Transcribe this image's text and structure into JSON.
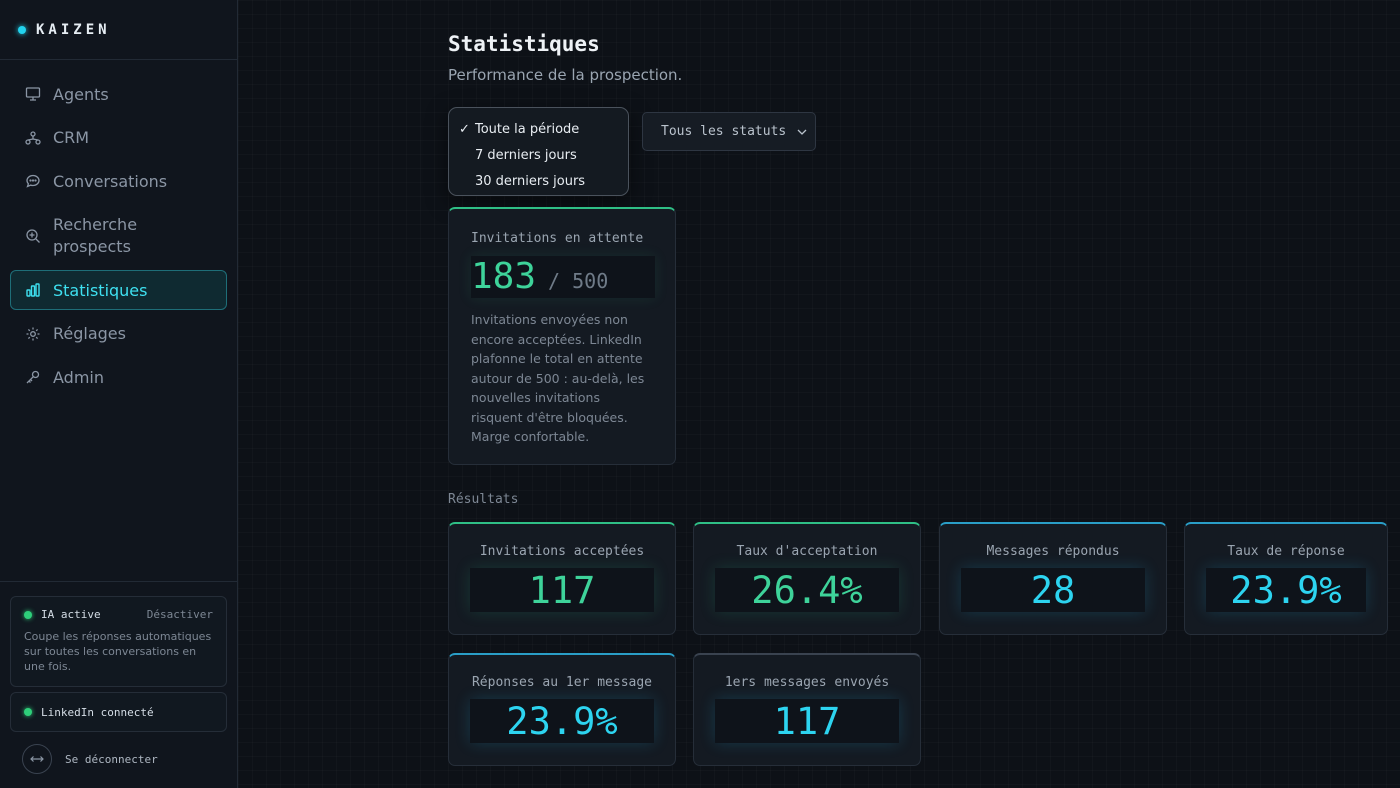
{
  "brand": {
    "name": "KAIZEN"
  },
  "sidebar": {
    "items": [
      {
        "label": "Agents",
        "icon": "monitor-icon",
        "active": false
      },
      {
        "label": "CRM",
        "icon": "network-icon",
        "active": false
      },
      {
        "label": "Conversations",
        "icon": "chat-bubble-icon",
        "active": false
      },
      {
        "label": "Recherche prospects",
        "icon": "search-plus-icon",
        "active": false
      },
      {
        "label": "Statistiques",
        "icon": "bar-chart-icon",
        "active": true
      },
      {
        "label": "Réglages",
        "icon": "gear-icon",
        "active": false
      },
      {
        "label": "Admin",
        "icon": "key-icon",
        "active": false
      }
    ],
    "ia": {
      "label": "IA active",
      "action": "Désactiver",
      "description": "Coupe les réponses automatiques sur toutes les conversations en une fois."
    },
    "linkedin": {
      "label": "LinkedIn connecté"
    },
    "logout": {
      "label": "Se déconnecter"
    }
  },
  "header": {
    "title": "Statistiques",
    "subtitle": "Performance de la prospection."
  },
  "filters": {
    "period": {
      "selected": "Toute la période",
      "options": [
        "Toute la période",
        "7 derniers jours",
        "30 derniers jours"
      ]
    },
    "status": {
      "selected": "Tous les statuts"
    }
  },
  "pending": {
    "label": "Invitations en attente",
    "value": "183",
    "max": "/ 500",
    "description": "Invitations envoyées non encore acceptées. LinkedIn plafonne le total en attente autour de 500 : au-delà, les nouvelles invitations risquent d'être bloquées. Marge confortable."
  },
  "results": {
    "section_label": "Résultats",
    "cards": [
      {
        "label": "Invitations acceptées",
        "value": "117"
      },
      {
        "label": "Taux d'acceptation",
        "value": "26.4%"
      },
      {
        "label": "Messages répondus",
        "value": "28"
      },
      {
        "label": "Taux de réponse",
        "value": "23.9%"
      },
      {
        "label": "Réponses au 1er message",
        "value": "23.9%"
      },
      {
        "label": "1ers messages envoyés",
        "value": "117"
      }
    ]
  },
  "colors": {
    "accent_cyan": "#22d3ee",
    "accent_green": "#2ecf7a",
    "background": "#0d1117"
  }
}
